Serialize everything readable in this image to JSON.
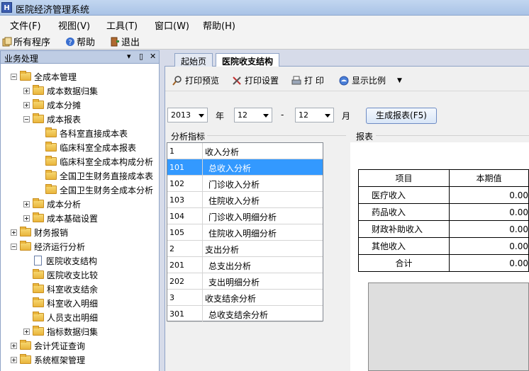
{
  "window": {
    "title": "医院经济管理系统",
    "icon_letter": "H"
  },
  "menu": [
    {
      "label": "文件(F)"
    },
    {
      "label": "视图(V)"
    },
    {
      "label": "工具(T)"
    },
    {
      "label": "窗口(W)"
    },
    {
      "label": "帮助(H)"
    }
  ],
  "commands": {
    "all_programs": "所有程序",
    "help": "帮助",
    "exit": "退出"
  },
  "left_panel": {
    "title": "业务处理",
    "pin_glyph": "▾ ᚚ ✕",
    "tree": [
      {
        "label": "全成本管理",
        "level": 0,
        "expander": "minus",
        "icon": "folder"
      },
      {
        "label": "成本数据归集",
        "level": 1,
        "expander": "plus",
        "icon": "folder"
      },
      {
        "label": "成本分摊",
        "level": 1,
        "expander": "plus",
        "icon": "folder"
      },
      {
        "label": "成本报表",
        "level": 1,
        "expander": "minus",
        "icon": "folder"
      },
      {
        "label": "各科室直接成本表",
        "level": 2,
        "expander": "none",
        "icon": "folder"
      },
      {
        "label": "临床科室全成本报表",
        "level": 2,
        "expander": "none",
        "icon": "folder"
      },
      {
        "label": "临床科室全成本构成分析",
        "level": 2,
        "expander": "none",
        "icon": "folder"
      },
      {
        "label": "全国卫生财务直接成本表",
        "level": 2,
        "expander": "none",
        "icon": "folder"
      },
      {
        "label": "全国卫生财务全成本分析",
        "level": 2,
        "expander": "none",
        "icon": "folder"
      },
      {
        "label": "成本分析",
        "level": 1,
        "expander": "plus",
        "icon": "folder"
      },
      {
        "label": "成本基础设置",
        "level": 1,
        "expander": "plus",
        "icon": "folder"
      },
      {
        "label": "财务报销",
        "level": 0,
        "expander": "plus",
        "icon": "folder"
      },
      {
        "label": "经济运行分析",
        "level": 0,
        "expander": "minus",
        "icon": "folder"
      },
      {
        "label": "医院收支结构",
        "level": 1,
        "expander": "none",
        "icon": "doc"
      },
      {
        "label": "医院收支比较",
        "level": 1,
        "expander": "none",
        "icon": "folder"
      },
      {
        "label": "科室收支结余",
        "level": 1,
        "expander": "none",
        "icon": "folder"
      },
      {
        "label": "科室收入明细",
        "level": 1,
        "expander": "none",
        "icon": "folder"
      },
      {
        "label": "人员支出明细",
        "level": 1,
        "expander": "none",
        "icon": "folder"
      },
      {
        "label": "指标数据归集",
        "level": 1,
        "expander": "plus",
        "icon": "folder"
      },
      {
        "label": "会计凭证查询",
        "level": 0,
        "expander": "plus",
        "icon": "folder"
      },
      {
        "label": "系统框架管理",
        "level": 0,
        "expander": "plus",
        "icon": "folder"
      }
    ]
  },
  "tabs": [
    {
      "label": "起始页",
      "active": false
    },
    {
      "label": "医院收支结构",
      "active": true
    }
  ],
  "report_toolbar": {
    "print_preview": "打印预览",
    "print_setup": "打印设置",
    "print": "打 印",
    "zoom": "显示比例"
  },
  "filter": {
    "year": "2013",
    "year_label": "年",
    "month_from": "12",
    "dash": "-",
    "month_to": "12",
    "month_label": "月",
    "generate_button": "生成报表(F5)"
  },
  "indicator_panel": {
    "title": "分析指标",
    "rows": [
      {
        "code": "1",
        "name": "收入分析",
        "selected": false
      },
      {
        "code": "101",
        "name": "总收入分析",
        "selected": true
      },
      {
        "code": "102",
        "name": "门诊收入分析",
        "selected": false
      },
      {
        "code": "103",
        "name": "住院收入分析",
        "selected": false
      },
      {
        "code": "104",
        "name": "门诊收入明细分析",
        "selected": false
      },
      {
        "code": "105",
        "name": "住院收入明细分析",
        "selected": false
      },
      {
        "code": "2",
        "name": "支出分析",
        "selected": false
      },
      {
        "code": "201",
        "name": "总支出分析",
        "selected": false
      },
      {
        "code": "202",
        "name": "支出明细分析",
        "selected": false
      },
      {
        "code": "3",
        "name": "收支结余分析",
        "selected": false
      },
      {
        "code": "301",
        "name": "总收支结余分析",
        "selected": false
      }
    ]
  },
  "report": {
    "title": "报表",
    "headers": [
      "项目",
      "本期值"
    ],
    "rows": [
      {
        "item": "医疗收入",
        "value": "0.00"
      },
      {
        "item": "药品收入",
        "value": "0.00"
      },
      {
        "item": "财政补助收入",
        "value": "0.00"
      },
      {
        "item": "其他收入",
        "value": "0.00"
      },
      {
        "item": "合计",
        "value": "0.00"
      }
    ]
  }
}
